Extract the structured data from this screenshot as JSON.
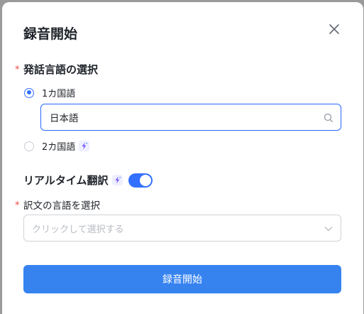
{
  "dialog": {
    "title": "録音開始",
    "close_icon": "close-icon"
  },
  "speech_language": {
    "required_mark": "*",
    "label": "発話言語の選択",
    "options": [
      {
        "label": "1カ国語",
        "checked": true
      },
      {
        "label": "2カ国語",
        "checked": false,
        "badge_icon": "sparkle-icon"
      }
    ],
    "selected_language": {
      "value": "日本語",
      "icon": "search-icon"
    }
  },
  "realtime_translation": {
    "label": "リアルタイム翻訳",
    "badge_icon": "sparkle-icon",
    "enabled": true
  },
  "target_language": {
    "required_mark": "*",
    "label": "訳文の言語を選択",
    "placeholder": "クリックして選択する",
    "icon": "chevron-down-icon"
  },
  "start_button": {
    "label": "録音開始"
  },
  "colors": {
    "accent": "#3370ff",
    "primary_button": "#3683f0",
    "required": "#f54a45"
  }
}
